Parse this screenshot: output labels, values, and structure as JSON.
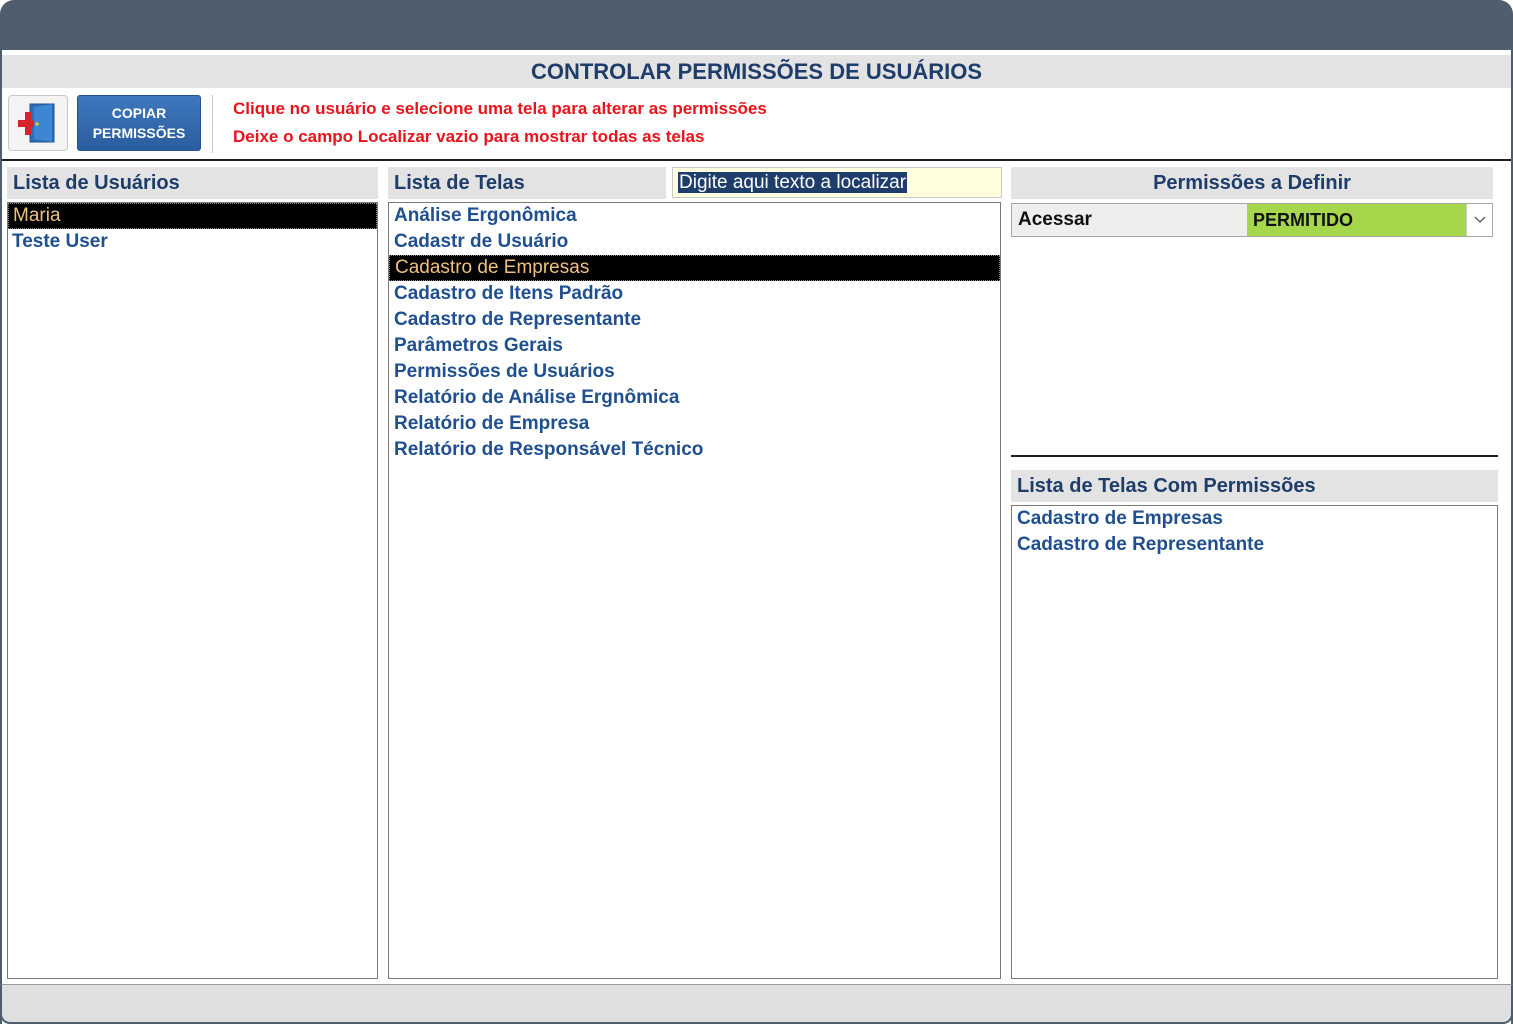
{
  "window": {
    "form_title": "CONTROLAR PERMISSÕES DE USUÁRIOS"
  },
  "toolbar": {
    "exit_icon": "exit-door-icon",
    "copy_label_line1": "COPIAR",
    "copy_label_line2": "PERMISSÕES",
    "instruction1": "Clique no usuário e selecione uma tela para alterar as permissões",
    "instruction2": "Deixe o campo Localizar vazio para mostrar todas as telas"
  },
  "users": {
    "header": "Lista de Usuários",
    "items": [
      {
        "label": "Maria",
        "selected": true
      },
      {
        "label": "Teste User",
        "selected": false
      }
    ]
  },
  "screens": {
    "header": "Lista de Telas",
    "search_value": "Digite aqui texto a localizar",
    "items": [
      {
        "label": "Análise Ergonômica",
        "selected": false
      },
      {
        "label": "Cadastr de Usuário",
        "selected": false
      },
      {
        "label": "Cadastro de Empresas",
        "selected": true
      },
      {
        "label": "Cadastro de Itens Padrão",
        "selected": false
      },
      {
        "label": "Cadastro de Representante",
        "selected": false
      },
      {
        "label": "Parâmetros Gerais",
        "selected": false
      },
      {
        "label": "Permissões de Usuários",
        "selected": false
      },
      {
        "label": "Relatório de Análise Ergnômica",
        "selected": false
      },
      {
        "label": "Relatório de Empresa",
        "selected": false
      },
      {
        "label": "Relatório de Responsável Técnico",
        "selected": false
      }
    ]
  },
  "permissions": {
    "header": "Permissões a Definir",
    "access_label": "Acessar",
    "access_value": "PERMITIDO",
    "access_color": "#a5d64b",
    "dropdown_icon": "chevron-down-icon"
  },
  "screens_with_permissions": {
    "header": "Lista de Telas Com Permissões",
    "items": [
      {
        "label": "Cadastro de Empresas"
      },
      {
        "label": "Cadastro de Representante"
      }
    ]
  },
  "colors": {
    "titlebar": "#505d6c",
    "header_text": "#1f3d6b",
    "list_text": "#1f4f8f",
    "instruction_text": "#e8141c",
    "copy_button": "#2a5d9f",
    "selection_bg": "#000000",
    "selection_text": "#f0c080"
  }
}
